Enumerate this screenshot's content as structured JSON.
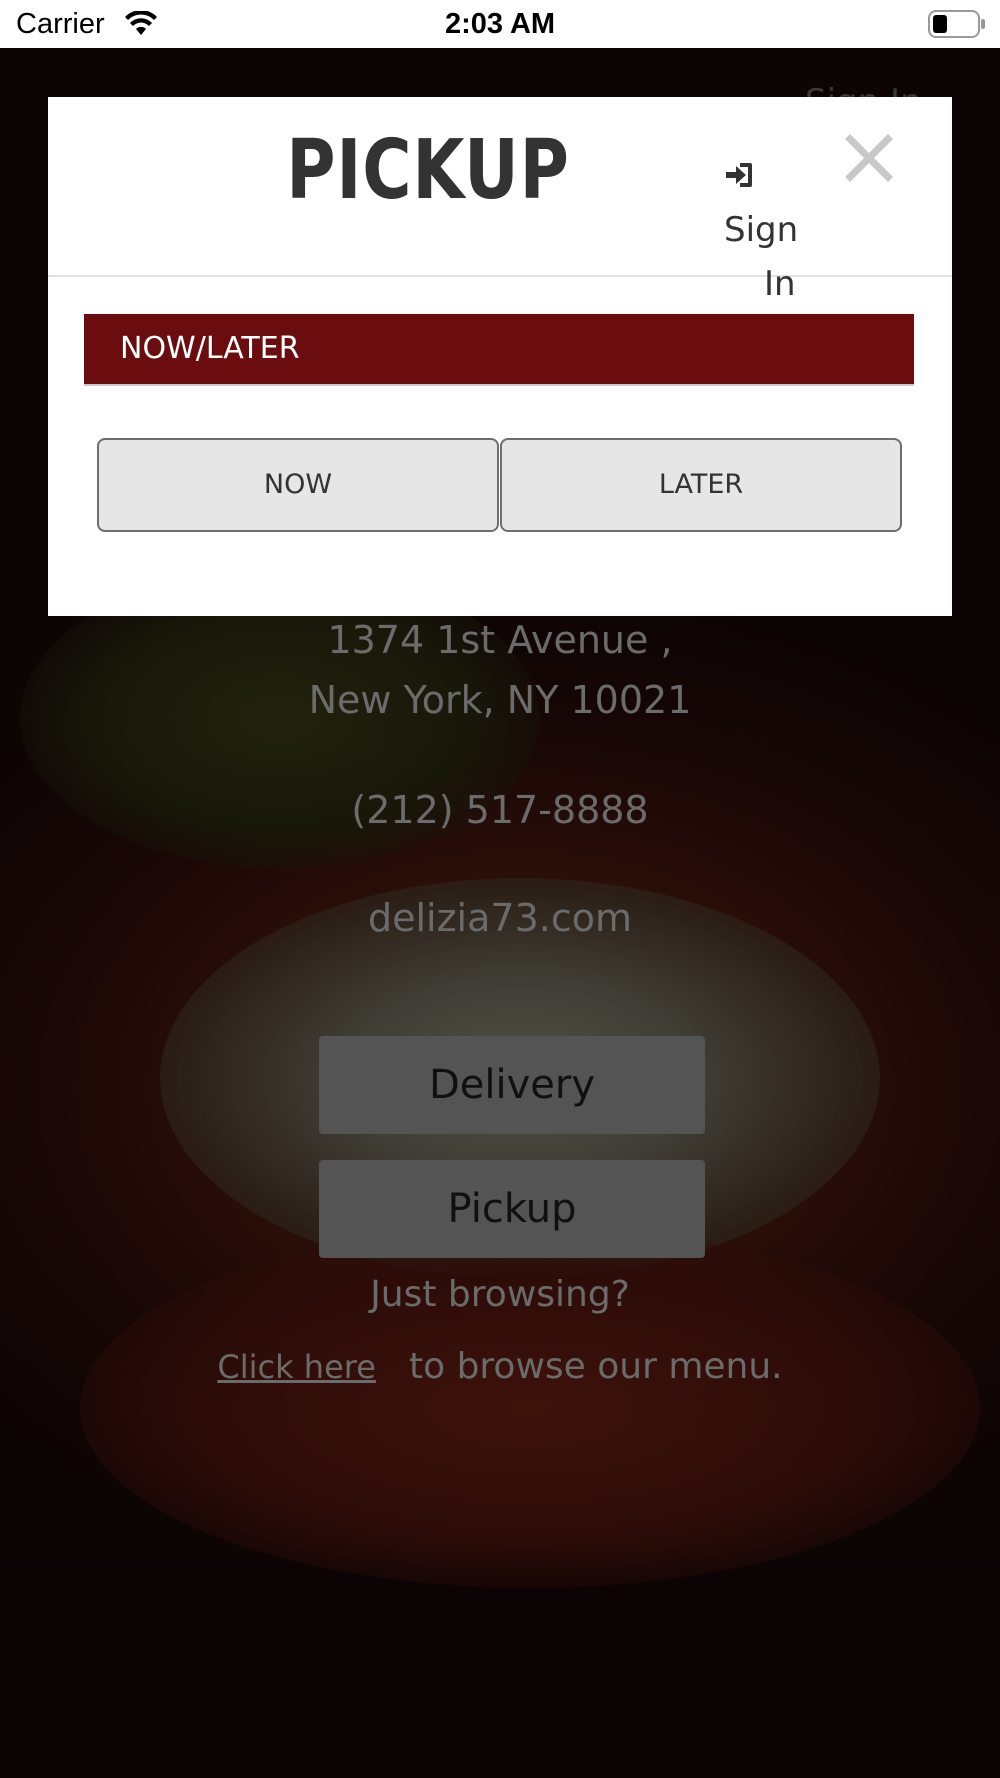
{
  "status_bar": {
    "carrier": "Carrier",
    "time": "2:03 AM",
    "wifi_icon": "wifi-icon",
    "battery_icon": "battery-icon"
  },
  "modal": {
    "title": "PICKUP",
    "sign_in": {
      "line1": "Sign",
      "line2": "In",
      "icon": "sign-in-icon"
    },
    "close_icon": "close-icon",
    "section_label": "NOW/LATER",
    "buttons": {
      "now": "NOW",
      "later": "LATER"
    }
  },
  "page": {
    "ghost_sign_in": "Sign In",
    "address_line1": "1374 1st Avenue ,",
    "address_line2": "New York, NY 10021",
    "phone": "(212) 517-8888",
    "website": "delizia73.com",
    "delivery_button": "Delivery",
    "pickup_button": "Pickup",
    "just_browsing": "Just browsing?",
    "click_here": "Click here",
    "browse_text": "to browse our menu."
  },
  "colors": {
    "section_bar": "#6b0d0e",
    "modal_bg": "#ffffff",
    "title_text": "#333333"
  }
}
